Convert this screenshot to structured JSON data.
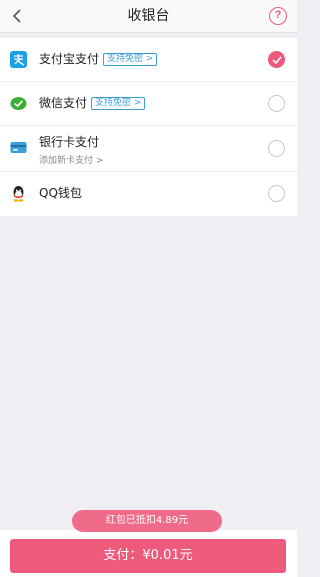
{
  "header": {
    "title": "收银台",
    "back_icon": "chevron-left-icon",
    "help_label": "?"
  },
  "methods": [
    {
      "label": "支付宝支付",
      "tag": "支持免密 >",
      "icon": "alipay-icon",
      "color": "#1aa0e8",
      "selected": true
    },
    {
      "label": "微信支付",
      "tag": "支持免密 >",
      "icon": "wechat-pay-icon",
      "color": "#3cb034",
      "selected": false
    },
    {
      "label": "银行卡支付",
      "sub": "添加新卡支付 >",
      "icon": "bank-card-icon",
      "color": "#3a9fd8",
      "selected": false
    },
    {
      "label": "QQ钱包",
      "icon": "qq-wallet-icon",
      "selected": false
    }
  ],
  "coupon": "红包已抵扣4.89元",
  "pay_button": "支付：¥0.01元",
  "accent": "#ee5a7c"
}
